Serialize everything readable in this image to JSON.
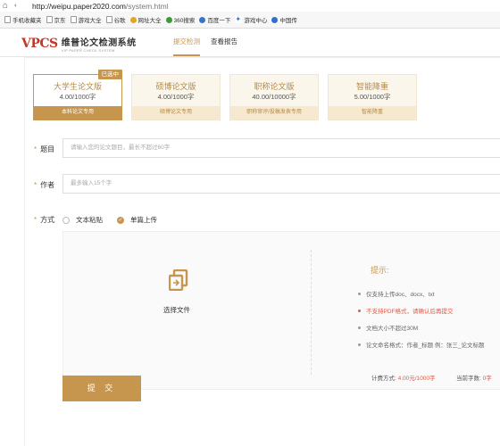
{
  "browser": {
    "url_host": "http://weipu.paper2020.com",
    "url_path": "/system.html",
    "bookmarks": [
      {
        "label": "手机收藏夹",
        "icon": "mobile-icon"
      },
      {
        "label": "京东",
        "icon": "page-icon"
      },
      {
        "label": "游戏大全",
        "icon": "page-icon"
      },
      {
        "label": "谷歌",
        "icon": "page-icon"
      },
      {
        "label": "网址大全",
        "icon": "globe-icon"
      },
      {
        "label": "360搜索",
        "icon": "search-icon"
      },
      {
        "label": "百度一下",
        "icon": "paw-icon"
      },
      {
        "label": "游戏中心",
        "icon": "game-icon"
      },
      {
        "label": "中国传",
        "icon": "page-icon"
      }
    ]
  },
  "header": {
    "logo_mark": "VPCS",
    "logo_cn": "维普论文检测系统",
    "logo_en": "VIP PAPER CHECK SYSTEM",
    "tabs": [
      {
        "label": "提交检测",
        "active": true
      },
      {
        "label": "查看报告",
        "active": false
      }
    ]
  },
  "cards": [
    {
      "title": "大学生论文版",
      "price": "4.00/1000字",
      "footer": "本科论文专用",
      "selected": true,
      "badge": "已选中"
    },
    {
      "title": "硕博论文版",
      "price": "4.00/1000字",
      "footer": "硕博论文专用",
      "selected": false,
      "badge": ""
    },
    {
      "title": "职称论文版",
      "price": "40.00/10000字",
      "footer": "职称审评/投稿发表专用",
      "selected": false,
      "badge": ""
    },
    {
      "title": "智能降重",
      "price": "5.00/1000字",
      "footer": "智能降重",
      "selected": false,
      "badge": ""
    }
  ],
  "form": {
    "title_label": "题目",
    "title_placeholder": "请输入您的论文题目，最长不超过60字",
    "author_label": "作者",
    "author_placeholder": "最多输入15个字",
    "method_label": "方式",
    "methods": [
      {
        "label": "文本粘贴",
        "checked": false
      },
      {
        "label": "单篇上传",
        "checked": true
      }
    ],
    "required_mark": "*"
  },
  "upload": {
    "choose_label": "选择文件",
    "tips_title": "提示:",
    "tips": [
      {
        "text": "仅支持上传doc、docx、txt",
        "highlight": false
      },
      {
        "text": "不支持PDF格式，请确认后再提交",
        "highlight": true
      },
      {
        "text": "文档大小不超过30M",
        "highlight": false
      },
      {
        "text": "论文命名格式：作者_标题 例：张三_论文标题",
        "highlight": false
      }
    ]
  },
  "fee": {
    "method_label": "计费方式:",
    "method_value": "4.00元/1000字",
    "count_label": "当前字数:",
    "count_value": "0字"
  },
  "submit_label": "提 交",
  "colors": {
    "accent": "#c7964e",
    "warn": "#e05a45"
  }
}
